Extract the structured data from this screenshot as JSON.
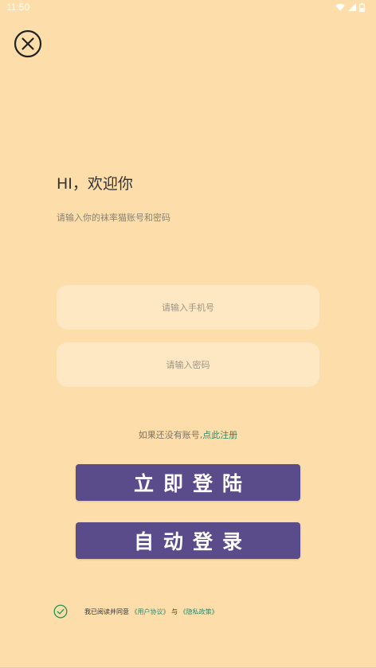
{
  "status_bar": {
    "time": "11:50",
    "icons": [
      "wifi-icon",
      "signal-icon",
      "battery-icon"
    ]
  },
  "header": {
    "close_icon": "close-icon"
  },
  "greeting": {
    "title": "HI，欢迎你",
    "subtitle": "请输入你的袜率猫账号和密码"
  },
  "form": {
    "phone_placeholder": "请输入手机号",
    "password_placeholder": "请输入密码"
  },
  "register": {
    "prompt": "如果还没有账号,",
    "link": "点此注册"
  },
  "buttons": {
    "login": "立即登陆",
    "auto_login": "自动登录"
  },
  "agreement": {
    "prefix": "我已阅读并同意",
    "user_agreement": "《用户协议》",
    "conjunction": "与",
    "privacy_policy": "《隐私政策》",
    "checked": true
  },
  "colors": {
    "background": "#fddeab",
    "field": "#fee8c4",
    "button": "#5a4b8b",
    "link": "#2c8a6b"
  }
}
